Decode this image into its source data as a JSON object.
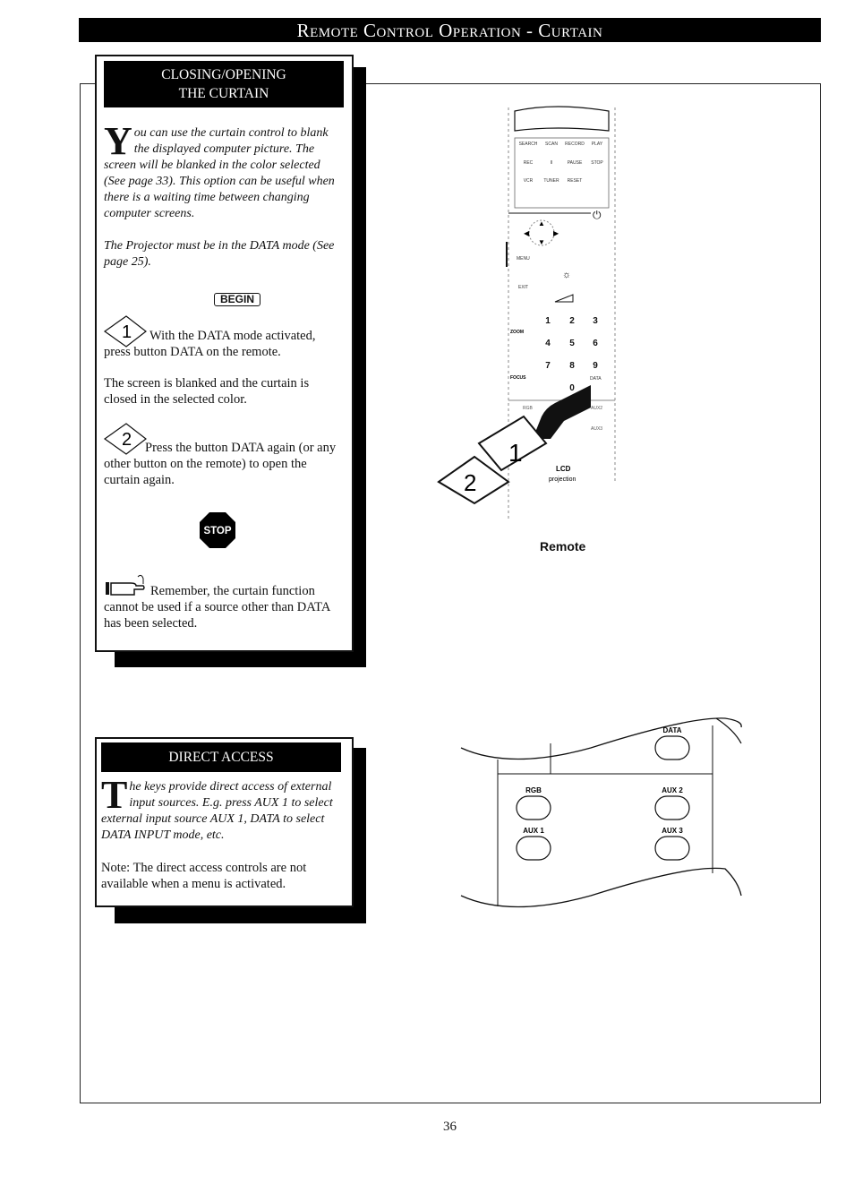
{
  "header": {
    "title": "Remote Control Operation - Curtain"
  },
  "closing_panel": {
    "heading_line1": "CLOSING/OPENING",
    "heading_line2": "THE CURTAIN",
    "intro_dropcap": "Y",
    "intro_rest": "ou can use the curtain control to blank the displayed computer picture. The screen will be blanked in the color selected (See page 33). This option can be useful when there is a waiting time between changing computer screens.",
    "mode_note": "The Projector must be in the DATA mode (See page 25).",
    "begin_label": "BEGIN",
    "step1_number": "1",
    "step1_text": "With the DATA mode activated, press button DATA on the remote.",
    "step1_result": "The screen is blanked and the curtain is closed in the selected color.",
    "step2_number": "2",
    "step2_text": "Press the button DATA again (or any other button on the remote) to open the curtain again.",
    "stop_label": "STOP",
    "remember_text": "Remember, the curtain function cannot be used if a source other than DATA has been selected."
  },
  "direct_panel": {
    "heading": "DIRECT ACCESS",
    "intro_dropcap": "T",
    "intro_rest": "he keys provide direct access of external input sources. E.g. press AUX 1 to select external input source AUX 1, DATA to select DATA INPUT mode, etc.",
    "note": "Note: The direct access controls are not available when a menu is activated."
  },
  "remote": {
    "caption": "Remote",
    "transport_labels": [
      "SEARCH",
      "SCAN",
      "RECORD",
      "PLAY",
      "REC",
      "II",
      "PAUSE",
      "STOP",
      "VCR",
      "TUNER",
      "RESET"
    ],
    "side_labels": {
      "menu": "MENU",
      "exit": "EXIT",
      "zoom": "ZOOM",
      "focus": "FOCUS",
      "data": "DATA",
      "rgb": "RGB",
      "aux2": "AUX2",
      "aux1": "AUX1",
      "aux3": "AUX3"
    },
    "keypad": [
      "1",
      "2",
      "3",
      "4",
      "5",
      "6",
      "7",
      "8",
      "9",
      "0"
    ],
    "brand_line1": "LCD",
    "brand_line2": "projection",
    "callout1": "1",
    "callout2": "2"
  },
  "detail": {
    "buttons": [
      "DATA",
      "RGB",
      "AUX 2",
      "AUX 1",
      "AUX 3"
    ]
  },
  "footer": {
    "page_number": "36"
  }
}
